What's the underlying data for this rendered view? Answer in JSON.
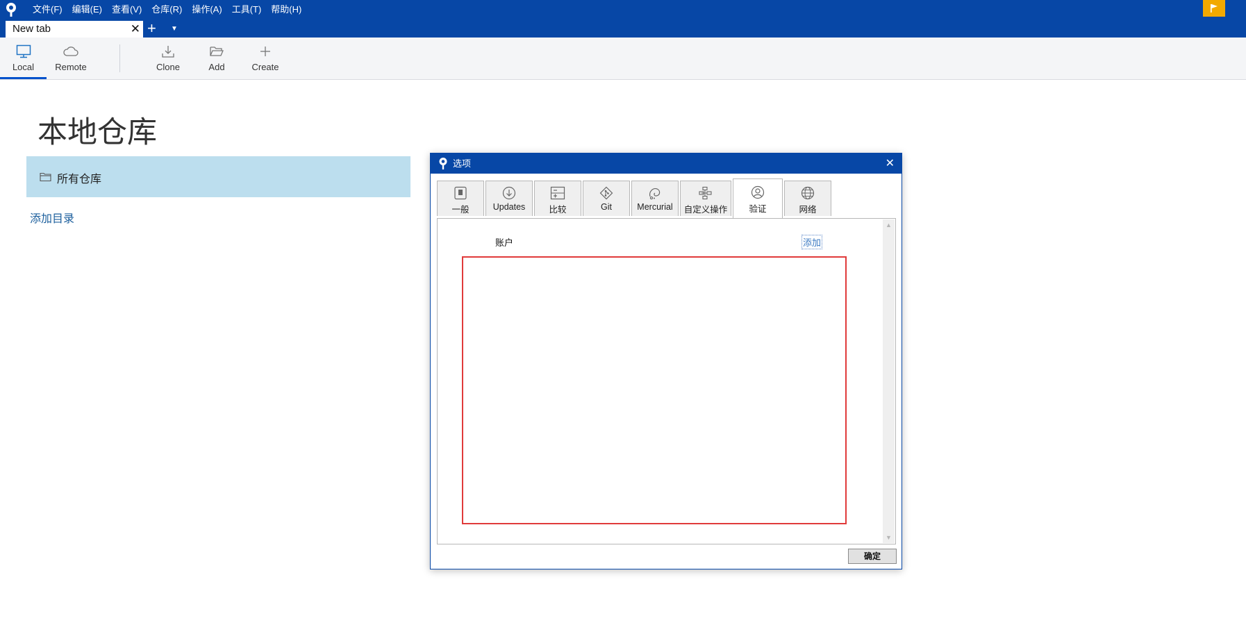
{
  "menu": {
    "items": [
      "文件(F)",
      "编辑(E)",
      "查看(V)",
      "仓库(R)",
      "操作(A)",
      "工具(T)",
      "帮助(H)"
    ]
  },
  "tabs": {
    "current": "New tab",
    "close_glyph": "✕",
    "add_glyph": "+",
    "more_glyph": "▼"
  },
  "toolbar": {
    "local_label": "Local",
    "remote_label": "Remote",
    "clone_label": "Clone",
    "add_label": "Add",
    "create_label": "Create"
  },
  "main": {
    "title": "本地仓库",
    "repo_group_label": "所有仓库",
    "add_directory_label": "添加目录"
  },
  "dialog": {
    "title": "选项",
    "close_glyph": "✕",
    "tabs": [
      {
        "label": "一般",
        "icon": "general-icon"
      },
      {
        "label": "Updates",
        "icon": "updates-icon"
      },
      {
        "label": "比较",
        "icon": "diff-icon"
      },
      {
        "label": "Git",
        "icon": "git-icon"
      },
      {
        "label": "Mercurial",
        "icon": "mercurial-icon"
      },
      {
        "label": "自定义操作",
        "icon": "custom-actions-icon"
      },
      {
        "label": "验证",
        "icon": "user-icon"
      },
      {
        "label": "网络",
        "icon": "globe-icon"
      }
    ],
    "active_tab": "验证",
    "account_label": "账户",
    "add_link": "添加",
    "ok_label": "确定",
    "scroll_up_glyph": "▲",
    "scroll_down_glyph": "▼"
  },
  "colors": {
    "brand_blue": "#0747a6",
    "flag_orange": "#f2a900",
    "selection_blue": "#bcdeee",
    "highlight_red": "#e03a3a"
  }
}
